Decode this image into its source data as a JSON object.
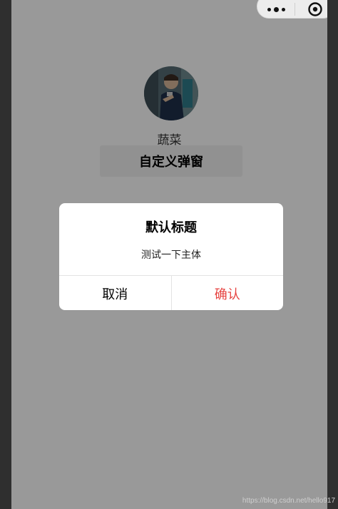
{
  "page": {
    "nickname": "蔬菜",
    "custom_button_label": "自定义弹窗"
  },
  "dialog": {
    "title": "默认标题",
    "content": "测试一下主体",
    "cancel_label": "取消",
    "confirm_label": "确认",
    "confirm_color": "#e64340"
  },
  "capsule": {
    "more_icon": "more-dots-icon",
    "close_icon": "target-close-icon"
  },
  "watermark": "https://blog.csdn.net/hello917"
}
